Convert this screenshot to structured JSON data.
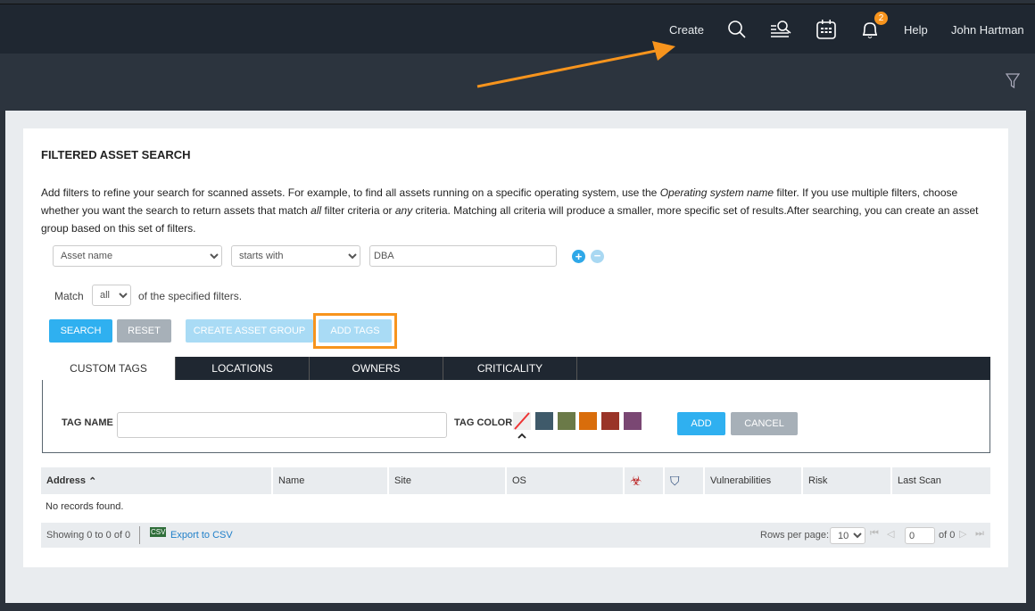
{
  "topbar": {
    "create": "Create",
    "help": "Help",
    "user": "John Hartman",
    "notifications": "2",
    "accent": "#f7941d"
  },
  "page": {
    "title": "FILTERED ASSET SEARCH",
    "desc_1": "Add filters to refine your search for scanned assets. For example, to find all assets running on a specific operating system, use the ",
    "desc_em1": "Operating system name",
    "desc_2": " filter. If you use multiple filters, choose whether you want the search to return assets that match ",
    "desc_em2": "all",
    "desc_3": " filter criteria or ",
    "desc_em3": "any",
    "desc_4": " criteria. Matching all criteria will produce a smaller, more specific set of results.After searching, you can create an asset group based on this set of filters."
  },
  "filter": {
    "field": "Asset name",
    "operator": "starts with",
    "value": "DBA"
  },
  "match": {
    "label": "Match",
    "value": "all",
    "suffix": "of the specified filters."
  },
  "buttons": {
    "search": "SEARCH",
    "reset": "RESET",
    "create_group": "CREATE ASSET GROUP",
    "add_tags": "ADD TAGS"
  },
  "tabs": [
    "CUSTOM TAGS",
    "LOCATIONS",
    "OWNERS",
    "CRITICALITY"
  ],
  "tag": {
    "name_label": "TAG NAME",
    "color_label": "TAG COLOR",
    "add": "ADD",
    "cancel": "CANCEL",
    "colors": [
      "#3f5a6a",
      "#6b7a48",
      "#d96d0b",
      "#9a3428",
      "#7a4773"
    ]
  },
  "table": {
    "columns": [
      "Address",
      "Name",
      "Site",
      "OS",
      "",
      "",
      "Vulnerabilities",
      "Risk",
      "Last Scan"
    ],
    "empty": "No records found."
  },
  "footer": {
    "showing": "Showing 0 to 0 of 0",
    "export": "Export to CSV",
    "rows_label": "Rows per page:",
    "rows": "10",
    "page": "0",
    "of": "of 0"
  }
}
